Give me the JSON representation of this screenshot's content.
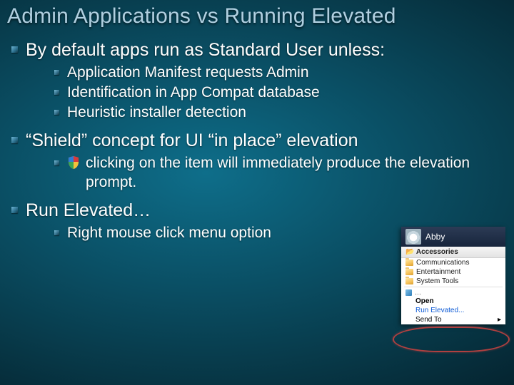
{
  "title": "Admin Applications vs Running Elevated",
  "b1": {
    "l1": "By default apps run as Standard User unless:",
    "s1": "Application Manifest requests Admin",
    "s2": "Identification in App Compat database",
    "s3": "Heuristic installer detection"
  },
  "b2": {
    "l1": "“Shield” concept for UI “in place” elevation",
    "s1": "clicking on the item will immediately produce the elevation prompt."
  },
  "b3": {
    "l1": "Run Elevated…",
    "s1": "Right mouse click menu option"
  },
  "menu": {
    "user": "Abby",
    "header": "Accessories",
    "items": [
      "Communications",
      "Entertainment",
      "System Tools"
    ],
    "ctx": {
      "open": "Open",
      "run": "Run Elevated...",
      "send": "Send To"
    }
  }
}
